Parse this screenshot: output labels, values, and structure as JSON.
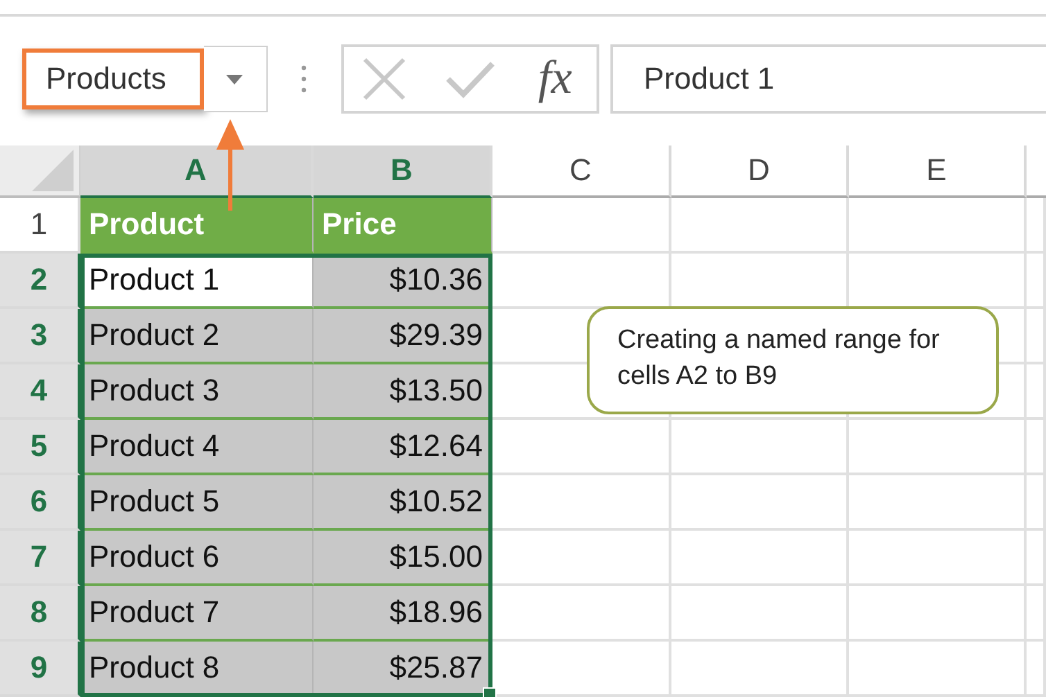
{
  "name_box": {
    "value": "Products",
    "highlighted": true
  },
  "formula_bar": {
    "function_label": "fx",
    "value": "Product 1"
  },
  "columns": [
    {
      "label": "A",
      "selected": true
    },
    {
      "label": "B",
      "selected": true
    },
    {
      "label": "C",
      "selected": false
    },
    {
      "label": "D",
      "selected": false
    },
    {
      "label": "E",
      "selected": false
    }
  ],
  "rows": [
    {
      "number": "1",
      "selected": false,
      "kind": "header",
      "cells": [
        {
          "text": "Product"
        },
        {
          "text": "Price"
        }
      ]
    },
    {
      "number": "2",
      "selected": true,
      "kind": "data",
      "cells": [
        {
          "text": "Product 1",
          "active": true
        },
        {
          "text": "$10.36",
          "active": false
        }
      ]
    },
    {
      "number": "3",
      "selected": true,
      "kind": "data",
      "cells": [
        {
          "text": "Product 2",
          "active": false
        },
        {
          "text": "$29.39",
          "active": false
        }
      ]
    },
    {
      "number": "4",
      "selected": true,
      "kind": "data",
      "cells": [
        {
          "text": "Product 3",
          "active": false
        },
        {
          "text": "$13.50",
          "active": false
        }
      ]
    },
    {
      "number": "5",
      "selected": true,
      "kind": "data",
      "cells": [
        {
          "text": "Product 4",
          "active": false
        },
        {
          "text": "$12.64",
          "active": false
        }
      ]
    },
    {
      "number": "6",
      "selected": true,
      "kind": "data",
      "cells": [
        {
          "text": "Product 5",
          "active": false
        },
        {
          "text": "$10.52",
          "active": false
        }
      ]
    },
    {
      "number": "7",
      "selected": true,
      "kind": "data",
      "cells": [
        {
          "text": "Product 6",
          "active": false
        },
        {
          "text": "$15.00",
          "active": false
        }
      ]
    },
    {
      "number": "8",
      "selected": true,
      "kind": "data",
      "cells": [
        {
          "text": "Product 7",
          "active": false
        },
        {
          "text": "$18.96",
          "active": false
        }
      ]
    },
    {
      "number": "9",
      "selected": true,
      "kind": "data",
      "cells": [
        {
          "text": "Product 8",
          "active": false
        },
        {
          "text": "$25.87",
          "active": false
        }
      ]
    }
  ],
  "callout": {
    "text": "Creating a named range for cells A2 to B9"
  }
}
